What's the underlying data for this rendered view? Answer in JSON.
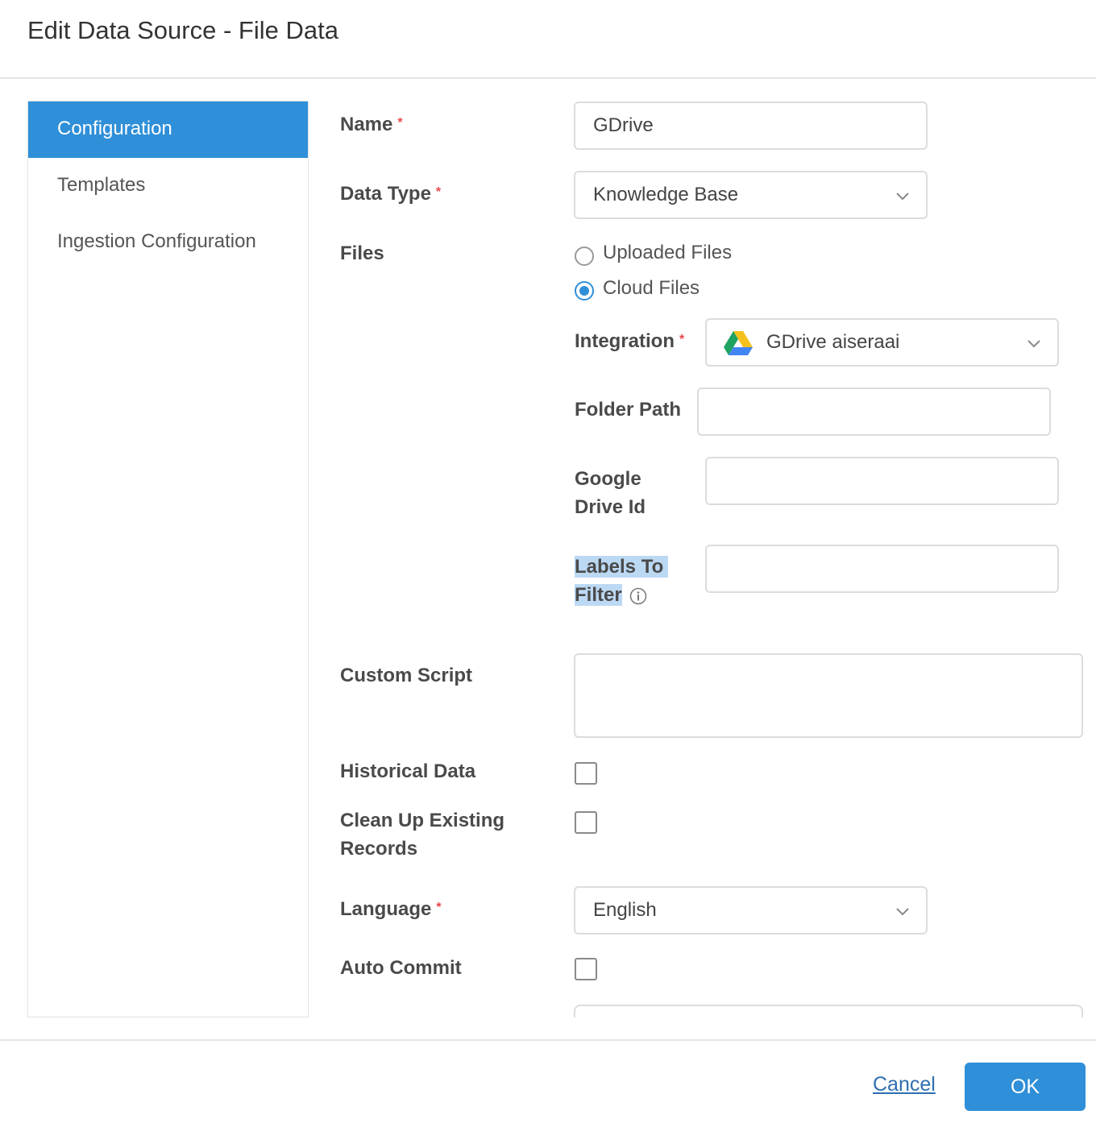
{
  "dialog": {
    "title": "Edit Data Source - File Data"
  },
  "sidebar": {
    "items": [
      {
        "label": "Configuration",
        "active": true
      },
      {
        "label": "Templates",
        "active": false
      },
      {
        "label": "Ingestion Configuration",
        "active": false
      }
    ]
  },
  "form": {
    "name": {
      "label": "Name",
      "value": "GDrive",
      "required": true
    },
    "data_type": {
      "label": "Data Type",
      "value": "Knowledge Base",
      "required": true
    },
    "files": {
      "label": "Files",
      "options": [
        {
          "label": "Uploaded Files",
          "selected": false
        },
        {
          "label": "Cloud Files",
          "selected": true
        }
      ]
    },
    "integration": {
      "label": "Integration",
      "value": "GDrive aiseraai",
      "icon": "google-drive-icon",
      "required": true
    },
    "folder_path": {
      "label": "Folder Path",
      "value": ""
    },
    "google_drive_id": {
      "label_line1": "Google",
      "label_line2": "Drive Id",
      "value": ""
    },
    "labels_to_filter": {
      "label_line1": "Labels To",
      "label_line2": "Filter",
      "value": "",
      "icon": "info-icon"
    },
    "custom_script": {
      "label": "Custom Script",
      "value": ""
    },
    "historical_data": {
      "label": "Historical Data",
      "checked": false
    },
    "clean_up": {
      "label_line1": "Clean Up Existing",
      "label_line2": "Records",
      "checked": false
    },
    "language": {
      "label": "Language",
      "value": "English",
      "required": true
    },
    "auto_commit": {
      "label": "Auto Commit",
      "checked": false
    },
    "required_marker": "*"
  },
  "footer": {
    "cancel_label": "Cancel",
    "ok_label": "OK"
  },
  "colors": {
    "accent": "#2f8fd8",
    "required": "#e5484d",
    "highlight": "#bcd9f4"
  }
}
